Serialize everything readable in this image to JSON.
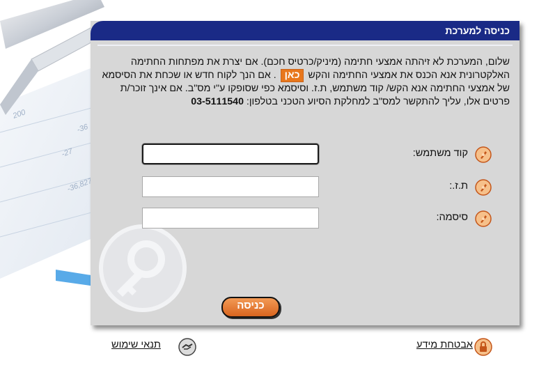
{
  "panel": {
    "title": "כניסה למערכת",
    "intro_part1": "שלום, המערכת לא זיהתה אמצעי חתימה (מיניק/כרטיס חכם). אם יצרת את מפתחות החתימה האלקטרונית אנא הכנס את אמצעי החתימה והקש",
    "here_link": "כאן",
    "intro_part2": ". אם הנך לקוח חדש או שכחת את הסיסמא של אמצעי החתימה אנא הקש/ קוד משתמש, ת.ז. וסיסמא כפי שסופקו ע\"י מס\"ב. אם אינך זוכר/ת פרטים אלו, עליך להתקשר למס\"ב למחלקת הסיוע הטכני בטלפון:",
    "phone": "03-5111540"
  },
  "form": {
    "user_code_label": "קוד משתמש:",
    "user_code_value": "",
    "id_label": "ת.ז.:",
    "id_value": "",
    "password_label": "סיסמה:",
    "password_value": "",
    "submit_label": "כניסה"
  },
  "footer": {
    "security_link": "אבטחת מידע",
    "terms_link": "תנאי שימוש"
  },
  "colors": {
    "header": "#1a2a86",
    "panel": "#d7d7d7",
    "accent": "#e8771c",
    "arrow": "#4aa3e6"
  },
  "icons": {
    "field": "pen-icon",
    "security": "lock-icon",
    "terms": "handshake-icon",
    "watermark": "key-icon"
  }
}
